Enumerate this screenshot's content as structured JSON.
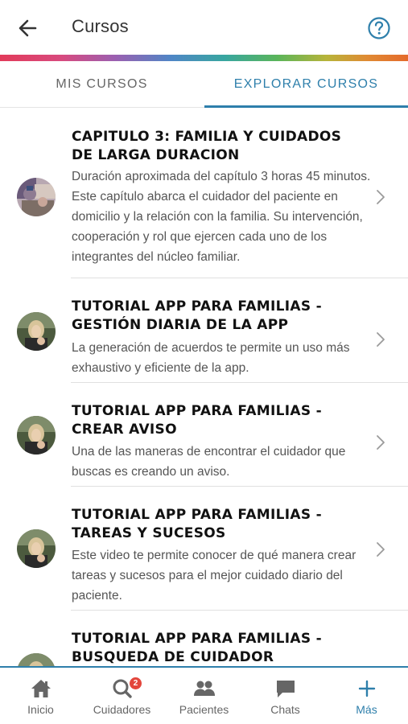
{
  "header": {
    "title": "Cursos",
    "back_icon": "arrow-left-icon",
    "help_icon": "help-circle-icon"
  },
  "tabs": [
    {
      "label": "MIS CURSOS",
      "active": false
    },
    {
      "label": "EXPLORAR CURSOS",
      "active": true
    }
  ],
  "courses": [
    {
      "title": "CAPITULO 3: FAMILIA Y CUIDADOS DE LARGA DURACION",
      "description": "Duración aproximada del capítulo 3 horas 45 minutos. Este capítulo abarca el cuidador del paciente en domicilio y la relación con la familia. Su intervención, cooperación y rol que ejercen cada uno de los integrantes del núcleo familiar."
    },
    {
      "title": "TUTORIAL APP PARA FAMILIAS -GESTIÓN DIARIA DE LA APP",
      "description": "La generación de acuerdos te permite un uso más exhaustivo y eficiente de la app."
    },
    {
      "title": "TUTORIAL APP PARA FAMILIAS -CREAR AVISO",
      "description": "Una de las maneras de encontrar el cuidador que buscas es creando un aviso."
    },
    {
      "title": "TUTORIAL APP PARA FAMILIAS -TAREAS Y SUCESOS",
      "description": "Este video te permite conocer de qué manera crear tareas y sucesos para el mejor cuidado diario del paciente."
    },
    {
      "title": "TUTORIAL APP PARA FAMILIAS - BUSQUEDA DE CUIDADOR",
      "description": ""
    }
  ],
  "bottom_nav": {
    "items": [
      {
        "label": "Inicio",
        "icon": "home-icon"
      },
      {
        "label": "Cuidadores",
        "icon": "search-icon",
        "badge": "2"
      },
      {
        "label": "Pacientes",
        "icon": "people-icon"
      },
      {
        "label": "Chats",
        "icon": "chat-icon"
      },
      {
        "label": "Más",
        "icon": "plus-icon",
        "active": true
      }
    ]
  },
  "colors": {
    "accent": "#2e7fab",
    "badge": "#e3463c"
  }
}
